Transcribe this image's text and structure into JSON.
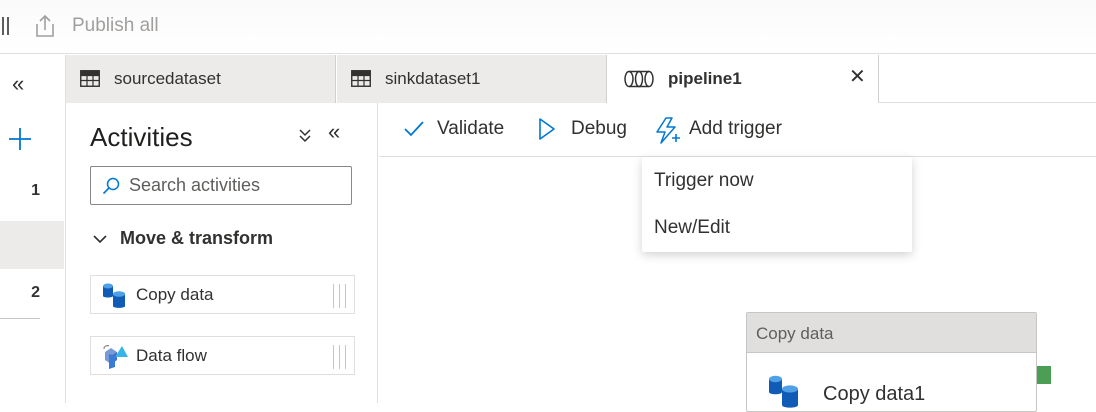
{
  "toolbar": {
    "publish_label": "Publish all"
  },
  "rail": {
    "collapse_glyph": "«",
    "items": [
      {
        "label": "1"
      },
      {
        "label": "2"
      }
    ]
  },
  "tabs": [
    {
      "label": "sourcedataset",
      "icon": "table-icon"
    },
    {
      "label": "sinkdataset1",
      "icon": "table-icon"
    },
    {
      "label": "pipeline1",
      "icon": "pipeline-icon",
      "active": true,
      "close_glyph": "✕"
    }
  ],
  "activities": {
    "title": "Activities",
    "collapse_glyph": "⌄⌄",
    "hide_glyph": "«",
    "search_placeholder": "Search activities",
    "group": {
      "label": "Move & transform",
      "expanded": true
    },
    "items": [
      {
        "label": "Copy data",
        "icon": "copy-data-icon"
      },
      {
        "label": "Data flow",
        "icon": "data-flow-icon"
      }
    ]
  },
  "canvas_toolbar": {
    "validate_label": "Validate",
    "debug_label": "Debug",
    "trigger_label": "Add trigger"
  },
  "trigger_menu": {
    "items": [
      {
        "label": "Trigger now"
      },
      {
        "label": "New/Edit"
      }
    ]
  },
  "node": {
    "type_label": "Copy data",
    "name": "Copy data1",
    "status_color": "#4c9e55"
  },
  "colors": {
    "accent": "#0078d4",
    "success": "#4c9e55"
  }
}
